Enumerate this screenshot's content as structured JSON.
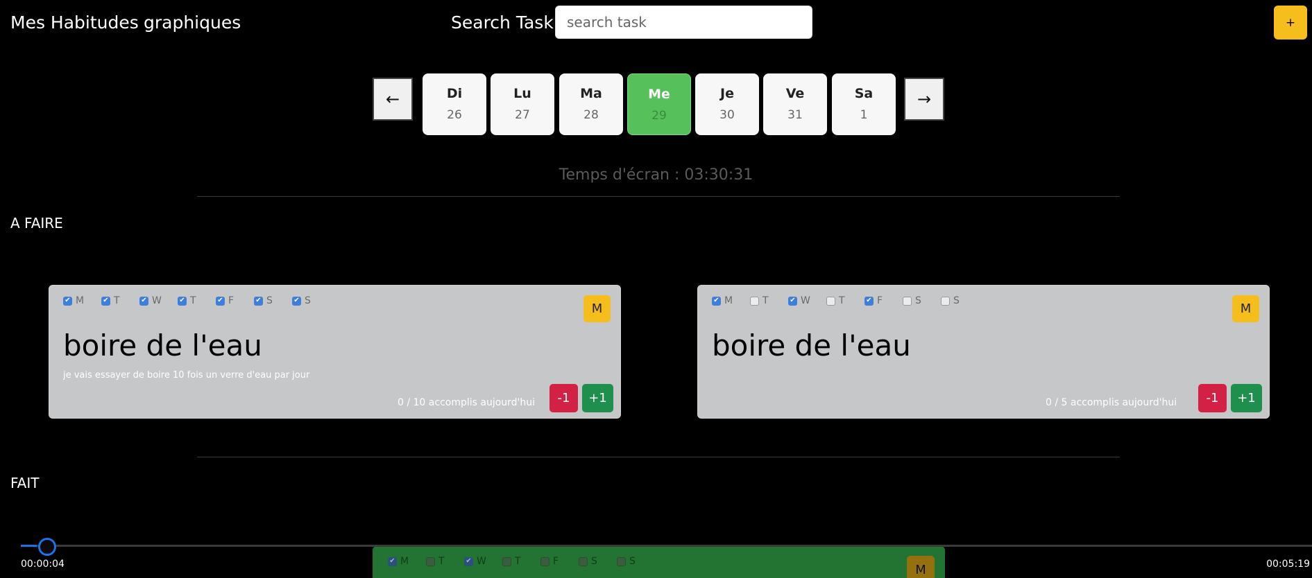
{
  "nav": {
    "title": "Mes Habitudes",
    "charts_link": "graphiques"
  },
  "search": {
    "label": "Search Task",
    "placeholder": "search task"
  },
  "add_button": {
    "label": "+"
  },
  "week": {
    "prev": "←",
    "next": "→",
    "days": [
      {
        "name": "Di",
        "num": "26"
      },
      {
        "name": "Lu",
        "num": "27"
      },
      {
        "name": "Ma",
        "num": "28"
      },
      {
        "name": "Me",
        "num": "29",
        "active": true
      },
      {
        "name": "Je",
        "num": "30"
      },
      {
        "name": "Ve",
        "num": "31"
      },
      {
        "name": "Sa",
        "num": "1"
      }
    ]
  },
  "screen_time": "Temps d'écran : 03:30:31",
  "sections": {
    "todo": "A FAIRE",
    "done": "FAIT"
  },
  "habits": [
    {
      "days": [
        {
          "label": "M",
          "checked": true
        },
        {
          "label": "T",
          "checked": true
        },
        {
          "label": "W",
          "checked": true
        },
        {
          "label": "T",
          "checked": true
        },
        {
          "label": "F",
          "checked": true
        },
        {
          "label": "S",
          "checked": true
        },
        {
          "label": "S",
          "checked": true
        }
      ],
      "badge": "M",
      "title": "boire de l'eau",
      "description": "je vais essayer de boire 10 fois un verre d'eau par jour",
      "progress": "0 / 10 accomplis aujourd'hui",
      "minus": "-1",
      "plus": "+1"
    },
    {
      "days": [
        {
          "label": "M",
          "checked": true
        },
        {
          "label": "T",
          "checked": false
        },
        {
          "label": "W",
          "checked": true
        },
        {
          "label": "T",
          "checked": false
        },
        {
          "label": "F",
          "checked": true
        },
        {
          "label": "S",
          "checked": false
        },
        {
          "label": "S",
          "checked": false
        }
      ],
      "badge": "M",
      "title": "boire de l'eau",
      "description": "",
      "progress": "0 / 5 accomplis aujourd'hui",
      "minus": "-1",
      "plus": "+1"
    }
  ],
  "done_habit": {
    "days": [
      {
        "label": "M",
        "checked": true
      },
      {
        "label": "T",
        "checked": false
      },
      {
        "label": "W",
        "checked": true
      },
      {
        "label": "T",
        "checked": false
      },
      {
        "label": "F",
        "checked": false
      },
      {
        "label": "S",
        "checked": false
      },
      {
        "label": "S",
        "checked": false
      }
    ],
    "badge": "M"
  },
  "video": {
    "current": "00:00:04",
    "total": "00:05:19",
    "progress": 0.0125
  },
  "colors": {
    "accent": "#f5be1c",
    "active_day": "#56c15a",
    "minus": "#d32045",
    "plus": "#1f8f4e",
    "done": "#237332"
  }
}
